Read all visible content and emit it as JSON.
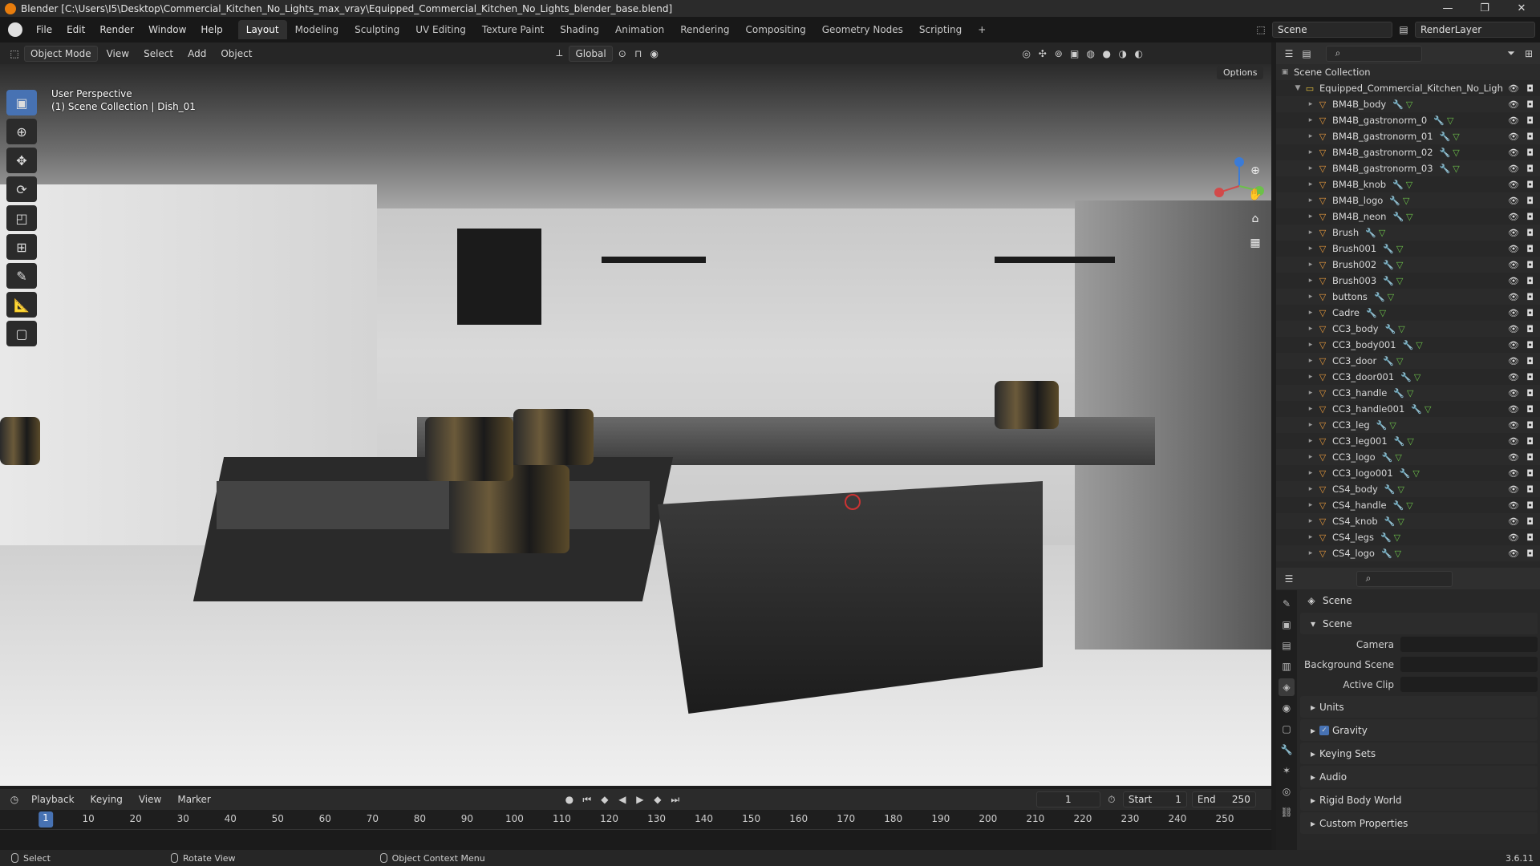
{
  "window": {
    "title": "Blender [C:\\Users\\I5\\Desktop\\Commercial_Kitchen_No_Lights_max_vray\\Equipped_Commercial_Kitchen_No_Lights_blender_base.blend]",
    "minimize": "—",
    "maximize": "❐",
    "close": "✕"
  },
  "menubar": {
    "items": [
      "File",
      "Edit",
      "Render",
      "Window",
      "Help"
    ],
    "workspaces": [
      "Layout",
      "Modeling",
      "Sculpting",
      "UV Editing",
      "Texture Paint",
      "Shading",
      "Animation",
      "Rendering",
      "Compositing",
      "Geometry Nodes",
      "Scripting",
      "+"
    ],
    "active_workspace": "Layout",
    "scene": "Scene",
    "view_layer": "RenderLayer"
  },
  "viewport_header": {
    "mode": "Object Mode",
    "menus": [
      "View",
      "Select",
      "Add",
      "Object"
    ],
    "orientation": "Global",
    "options": "Options"
  },
  "viewport": {
    "perspective": "User Perspective",
    "collection": "(1) Scene Collection | Dish_01"
  },
  "tools": {
    "select": "▣",
    "cursor": "⊕",
    "move": "✥",
    "rotate": "⟳",
    "scale": "◰",
    "transform": "⊞",
    "annotate": "✎",
    "measure": "📐",
    "add_cube": "▢"
  },
  "outliner": {
    "root": "Scene Collection",
    "collection": "Equipped_Commercial_Kitchen_No_Ligh",
    "objects": [
      "BM4B_body",
      "BM4B_gastronorm_0",
      "BM4B_gastronorm_01",
      "BM4B_gastronorm_02",
      "BM4B_gastronorm_03",
      "BM4B_knob",
      "BM4B_logo",
      "BM4B_neon",
      "Brush",
      "Brush001",
      "Brush002",
      "Brush003",
      "buttons",
      "Cadre",
      "CC3_body",
      "CC3_body001",
      "CC3_door",
      "CC3_door001",
      "CC3_handle",
      "CC3_handle001",
      "CC3_leg",
      "CC3_leg001",
      "CC3_logo",
      "CC3_logo001",
      "CS4_body",
      "CS4_handle",
      "CS4_knob",
      "CS4_legs",
      "CS4_logo"
    ]
  },
  "properties": {
    "context": "Scene",
    "panel": "Scene",
    "rows": [
      {
        "label": "Camera",
        "value": ""
      },
      {
        "label": "Background Scene",
        "value": ""
      },
      {
        "label": "Active Clip",
        "value": ""
      }
    ],
    "subpanels": [
      "Units",
      "Gravity",
      "Keying Sets",
      "Audio",
      "Rigid Body World",
      "Custom Properties"
    ]
  },
  "timeline": {
    "menus": [
      "Playback",
      "Keying",
      "View",
      "Marker"
    ],
    "current_frame": "1",
    "start_label": "Start",
    "start": "1",
    "end_label": "End",
    "end": "250",
    "ticks": [
      "1",
      "10",
      "20",
      "30",
      "40",
      "50",
      "60",
      "70",
      "80",
      "90",
      "100",
      "110",
      "120",
      "130",
      "140",
      "150",
      "160",
      "170",
      "180",
      "190",
      "200",
      "210",
      "220",
      "230",
      "240",
      "250"
    ]
  },
  "statusbar": {
    "select": "Select",
    "rotate": "Rotate View",
    "context": "Object Context Menu",
    "version": "3.6.11"
  }
}
